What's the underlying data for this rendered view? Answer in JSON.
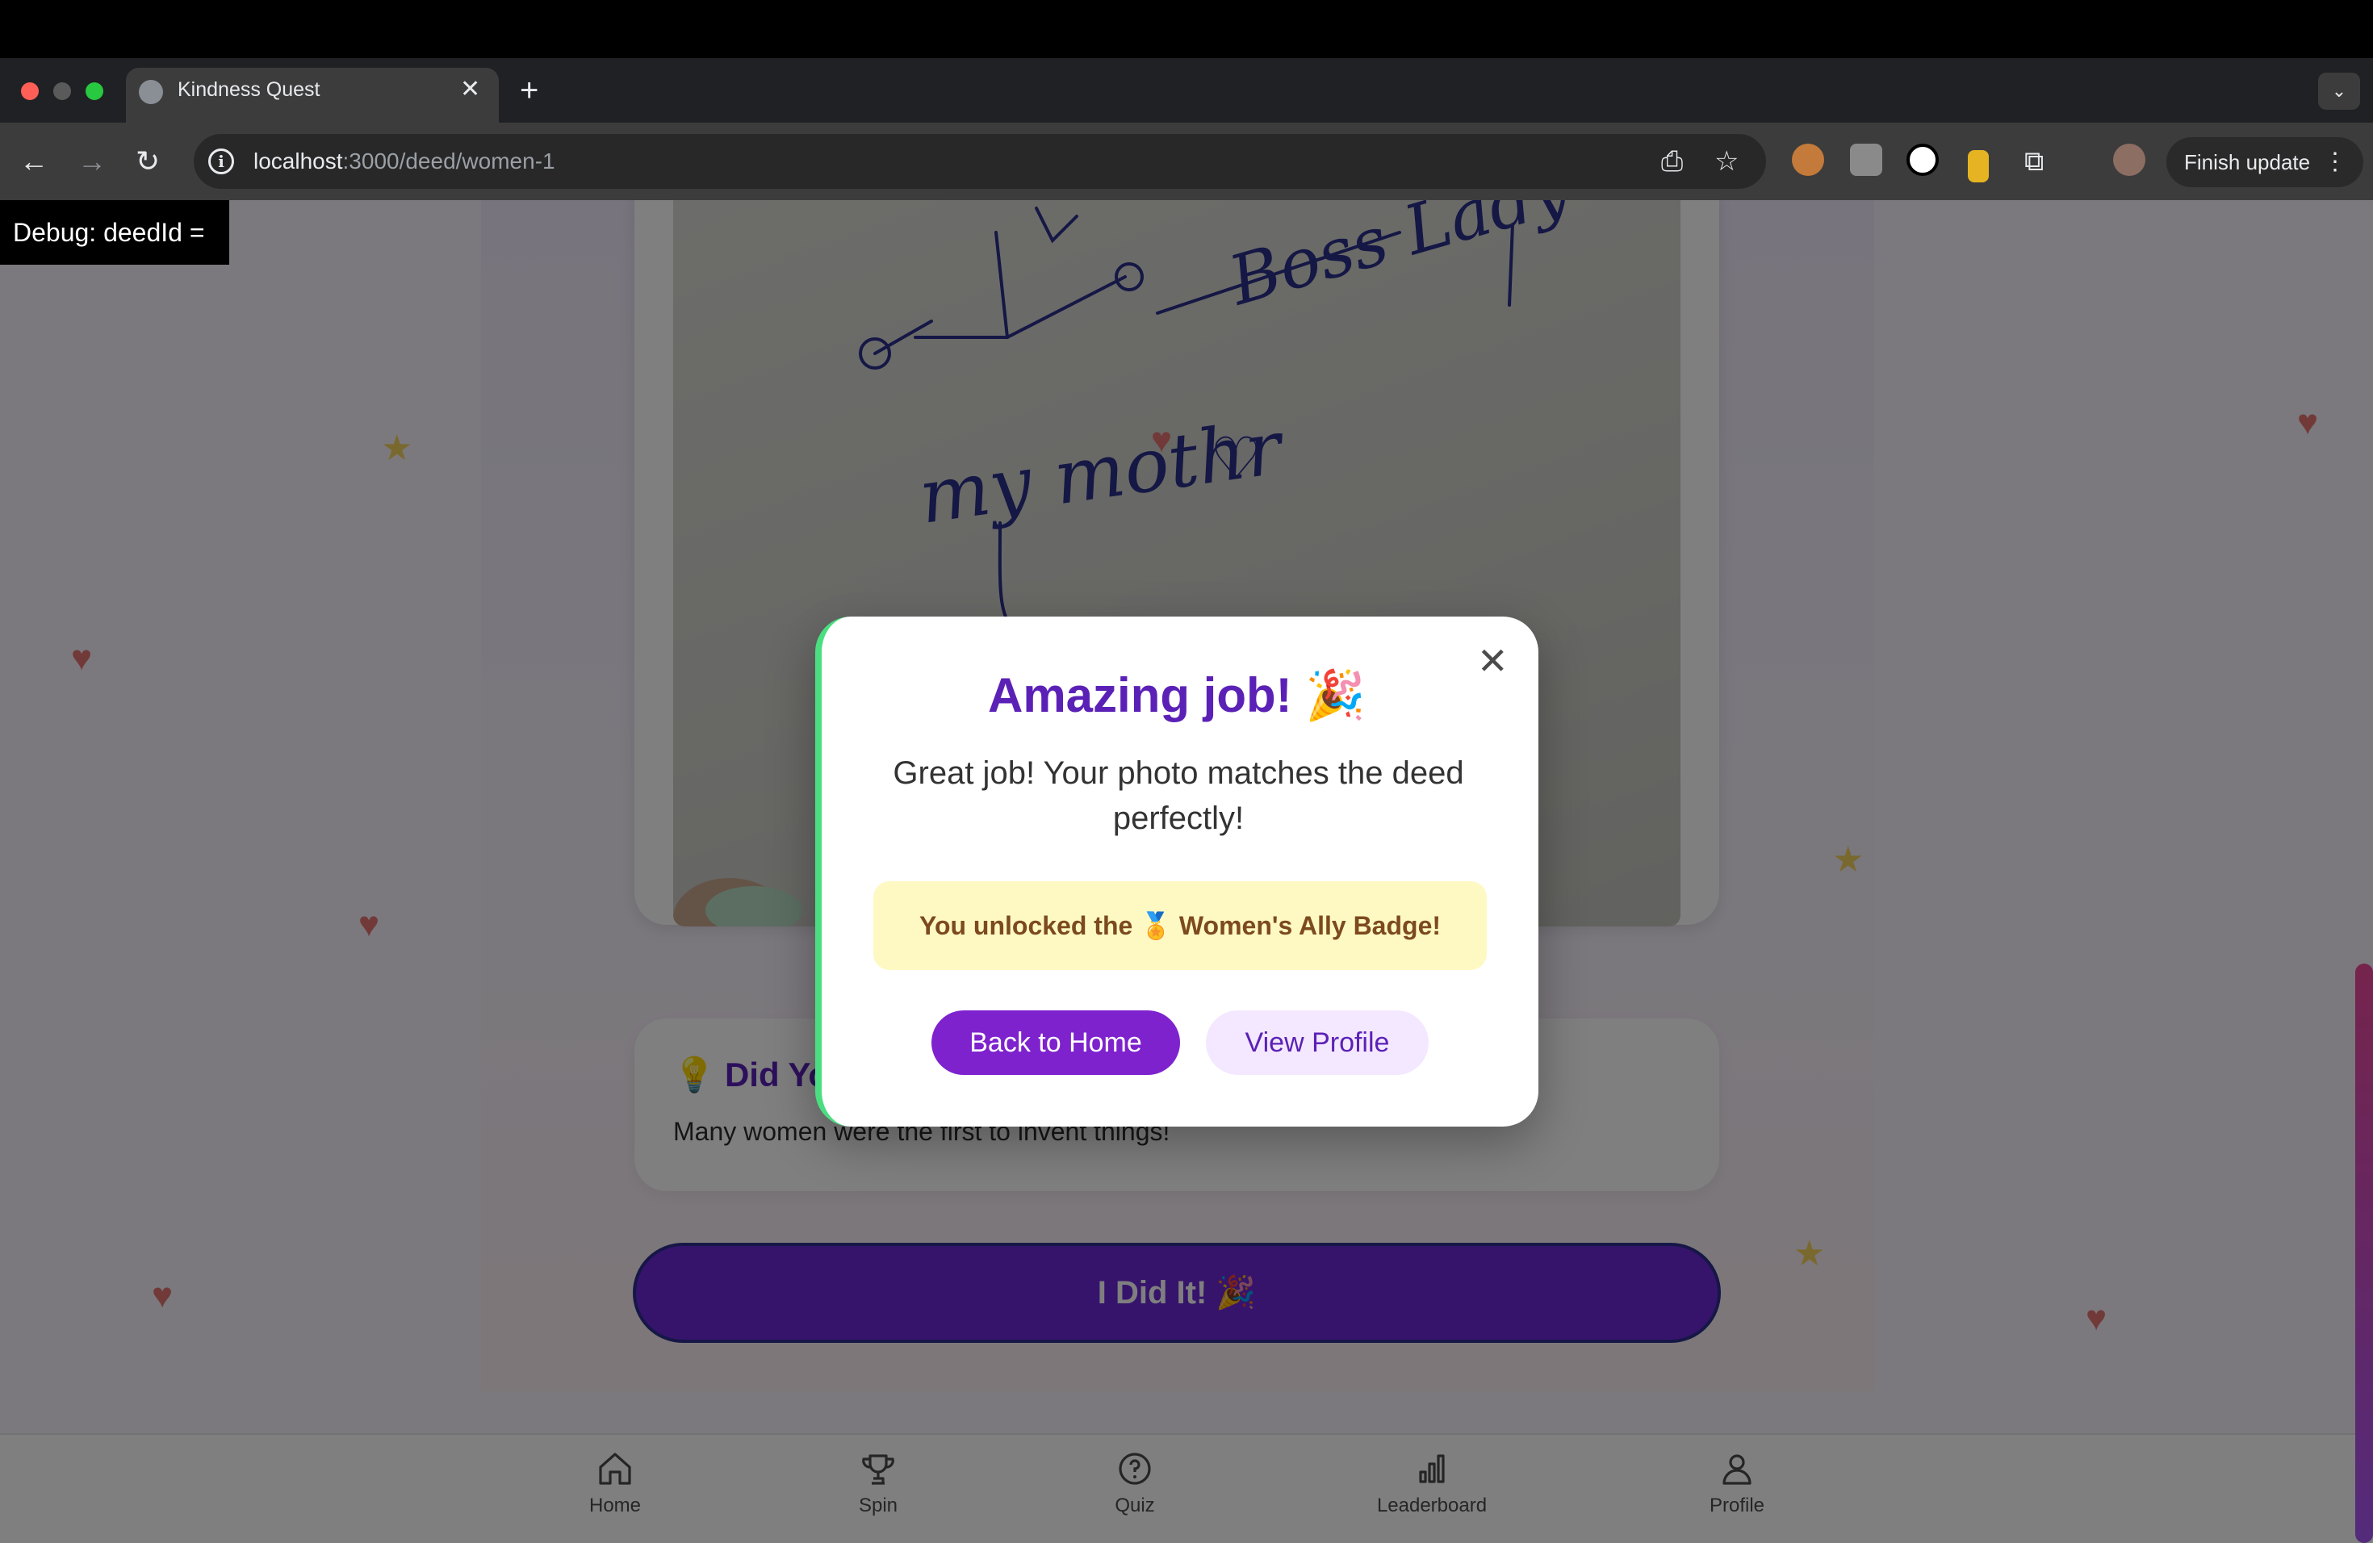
{
  "browser": {
    "tab_title": "Kindness Quest",
    "url_host": "localhost",
    "url_path": ":3000/deed/women-1",
    "finish_update_label": "Finish update"
  },
  "debug": {
    "label": "Debug: deedId ="
  },
  "page": {
    "photo_handwriting_1": "my mothr",
    "photo_handwriting_2": "Boss Lady",
    "fact_title": "💡 Did Yo",
    "fact_text": "Many women were the first to invent things!",
    "did_it_button": "I Did It! 🎉"
  },
  "modal": {
    "title": "Amazing job! 🎉",
    "message": "Great job! Your photo matches the deed perfectly!",
    "badge_text": "You unlocked the 🏅 Women's Ally Badge!",
    "back_home_button": "Back to Home",
    "view_profile_button": "View Profile",
    "close_icon": "close-icon"
  },
  "nav": {
    "items": [
      {
        "label": "Home",
        "icon": "home-icon"
      },
      {
        "label": "Spin",
        "icon": "trophy-icon"
      },
      {
        "label": "Quiz",
        "icon": "question-circle-icon"
      },
      {
        "label": "Leaderboard",
        "icon": "bar-chart-icon"
      },
      {
        "label": "Profile",
        "icon": "user-icon"
      }
    ]
  },
  "colors": {
    "accent": "#7e22ce",
    "title_purple": "#5b21b6",
    "badge_bg": "#fef9c3",
    "modal_accent_border": "#4ade80"
  }
}
